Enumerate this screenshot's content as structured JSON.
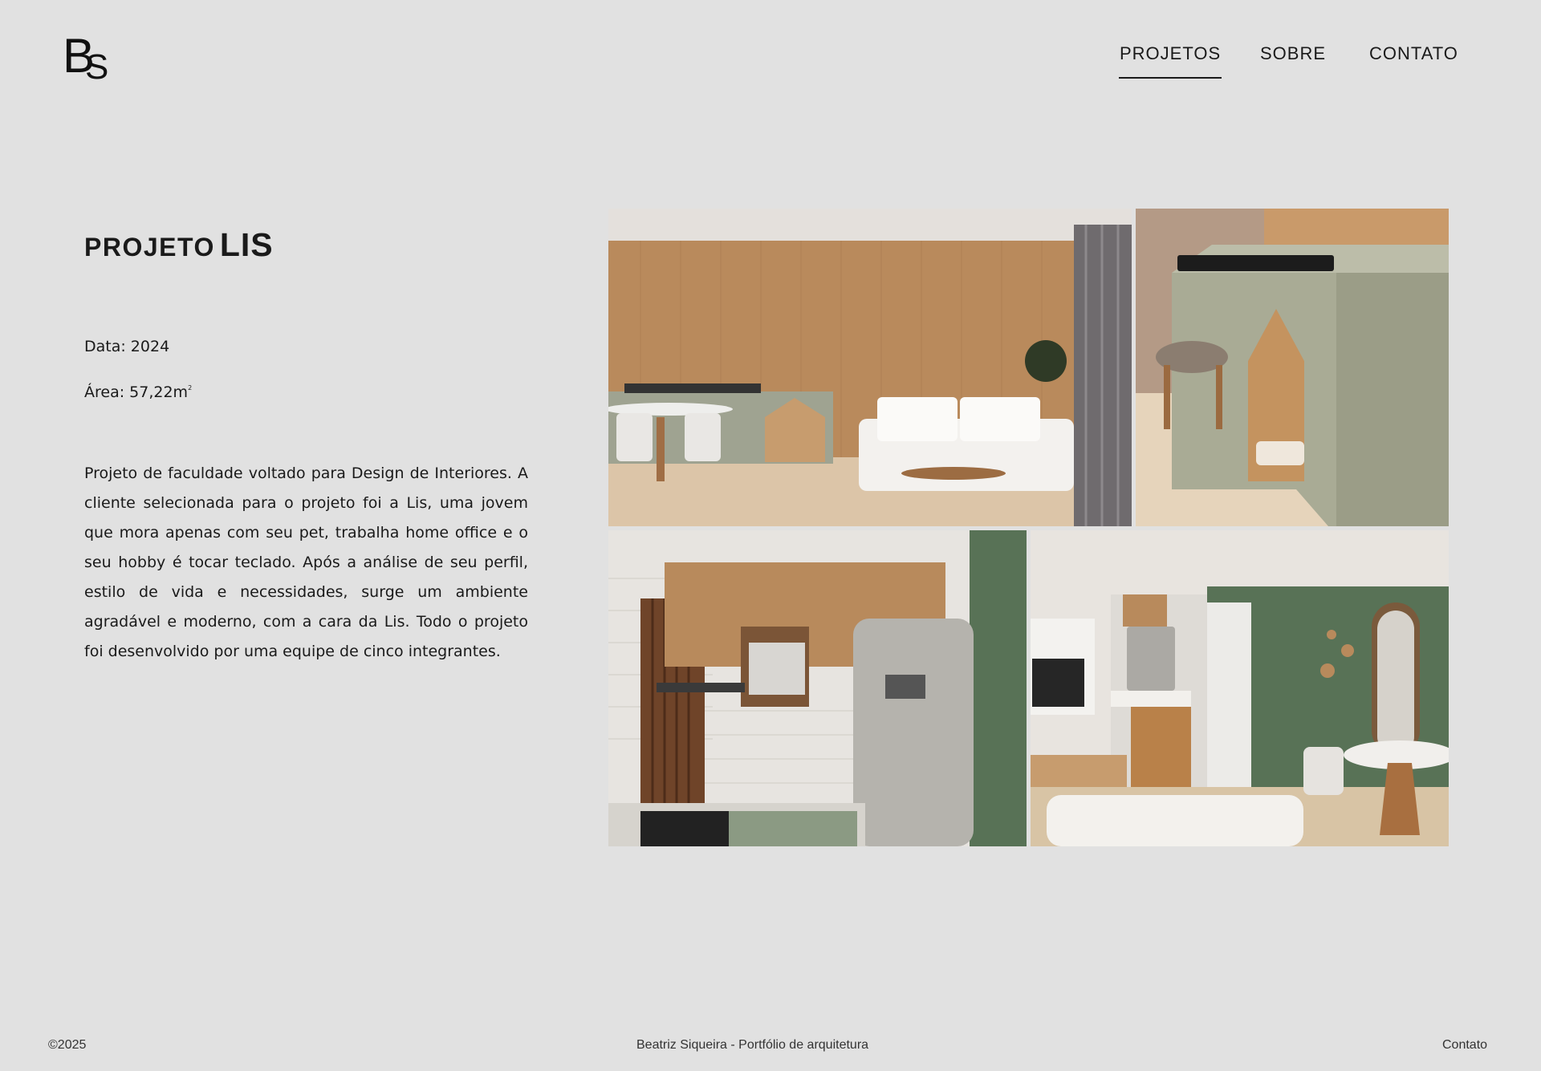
{
  "header": {
    "logo_text": "BS",
    "nav": [
      {
        "label": "PROJETOS",
        "active": true
      },
      {
        "label": "SOBRE",
        "active": false
      },
      {
        "label": "CONTATO",
        "active": false
      }
    ]
  },
  "project": {
    "title_prefix": "PROJETO",
    "title_name": "LIS",
    "date": "Data: 2024",
    "area": "Área: 57,22m",
    "area_sup": "2",
    "description": "Projeto de faculdade voltado para Design de Interiores. A cliente selecionada para o projeto foi a Lis, uma jovem que mora apenas com seu pet, trabalha home office e o seu hobby é tocar teclado. Após a análise de seu perfil, estilo de vida e necessidades, surge um ambiente agradável e moderno, com a cara da Lis. Todo o projeto foi desenvolvido por uma equipe de cinco integrantes."
  },
  "gallery": {
    "images": [
      "living-room-render",
      "pet-house-desk-render",
      "kitchen-render",
      "living-dining-render"
    ]
  },
  "footer": {
    "copyright": "©2025",
    "credit": "Beatriz Siqueira - Portfólio de arquitetura",
    "contact": "Contato"
  },
  "colors": {
    "background": "#e1e1e1",
    "text": "#1a1a1a",
    "wood": "#b98a5c",
    "sage": "#a9ab95",
    "green": "#587256"
  }
}
